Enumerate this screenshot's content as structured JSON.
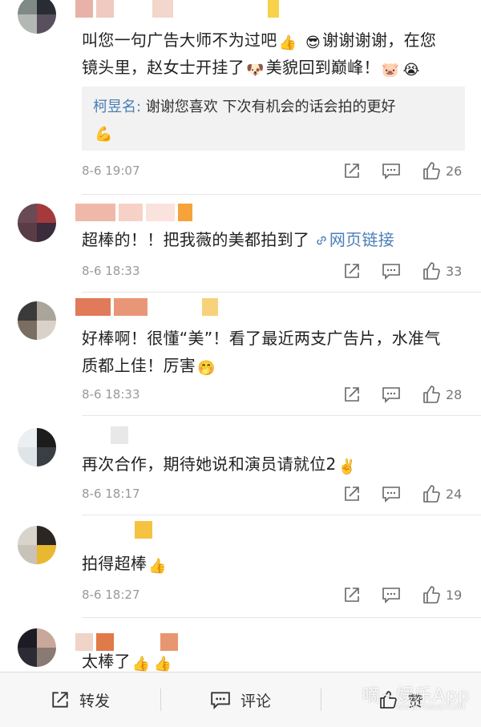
{
  "comments": [
    {
      "text_a": "叫您一句广告大师不为过吧",
      "text_b": "谢谢谢谢，在您",
      "text_c": "镜头里，赵女士开挂了",
      "text_d": "美貌回到巅峰！",
      "reply_author": "柯昱名:",
      "reply_text": "谢谢您喜欢 下次有机会的话会拍的更好",
      "time": "8-6 19:07",
      "likes": "26"
    },
    {
      "text": "超棒的！！把我薇的美都拍到了",
      "link_text": "网页链接",
      "time": "8-6 18:33",
      "likes": "33"
    },
    {
      "text_line1": "好棒啊！很懂“美”！看了最近两支广告片，水准气",
      "text_line2": "质都上佳！厉害",
      "time": "8-6 18:33",
      "likes": "28"
    },
    {
      "text": "再次合作，期待她说和演员请就位2",
      "time": "8-6 18:17",
      "likes": "24"
    },
    {
      "text": "拍得超棒",
      "time": "8-6 18:27",
      "likes": "19"
    },
    {
      "text": "太棒了"
    }
  ],
  "bottom_bar": {
    "repost_label": "转发",
    "comment_label": "评论",
    "like_label": "赞"
  },
  "watermark": {
    "main": "嘀~娱乐App",
    "sub": "WWW.TOSUZI.COM"
  },
  "icons": {
    "repost": "share-arrow-icon",
    "comment": "comment-bubble-icon",
    "like": "thumbs-up-icon"
  },
  "colors": {
    "link": "#4a7eb6",
    "meta": "#999999",
    "reply_bg": "#f2f2f2"
  }
}
